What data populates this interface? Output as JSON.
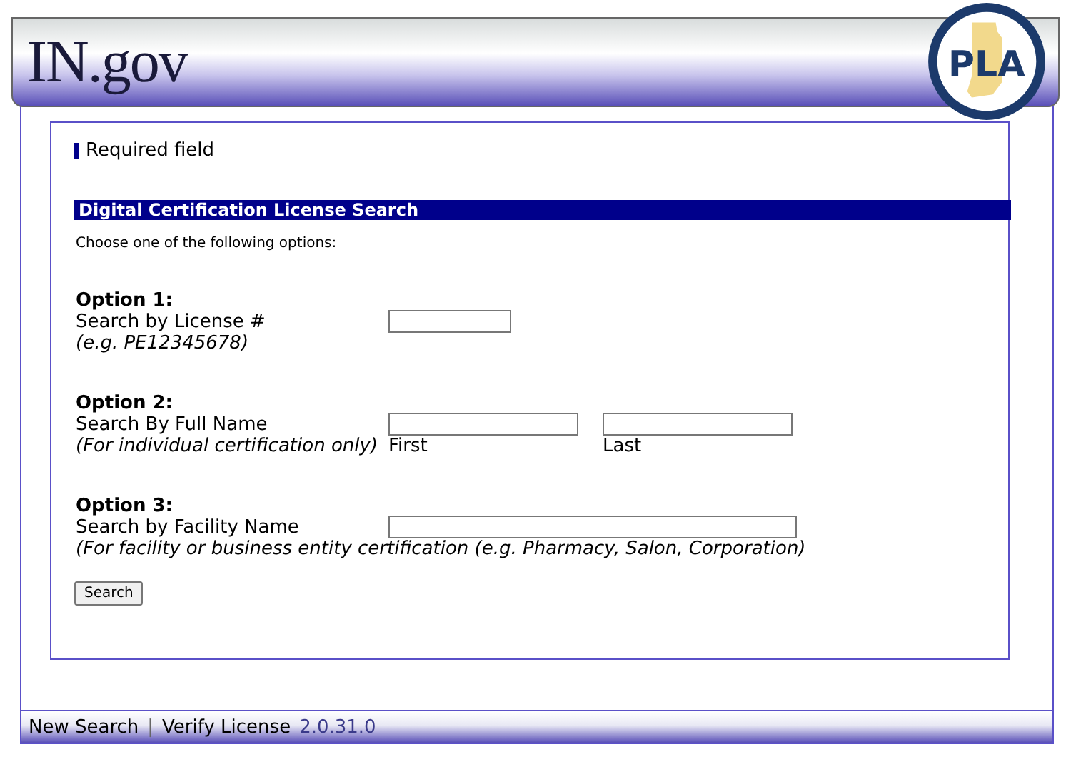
{
  "header": {
    "logo": "IN.gov",
    "seal": "PLA"
  },
  "required_note": "Required field",
  "section": {
    "title": "Digital Certification License Search",
    "intro": "Choose one of the following options:"
  },
  "options": [
    {
      "kind": "single",
      "title": "Option 1:",
      "label": "Search by License #",
      "hint": "(e.g. PE12345678)"
    },
    {
      "kind": "pair",
      "title": "Option 2:",
      "label": "Search By Full Name",
      "hint": "(For individual certification only)",
      "captions": [
        "First",
        "Last"
      ]
    },
    {
      "kind": "wide",
      "title": "Option 3:",
      "label": "Search by Facility Name",
      "hint": "(For facility or business entity certification (e.g. Pharmacy, Salon, Corporation)"
    }
  ],
  "search_button": "Search",
  "footer": {
    "links": [
      "New Search",
      "Verify License"
    ],
    "separator": "|",
    "version": "2.0.31.0"
  }
}
